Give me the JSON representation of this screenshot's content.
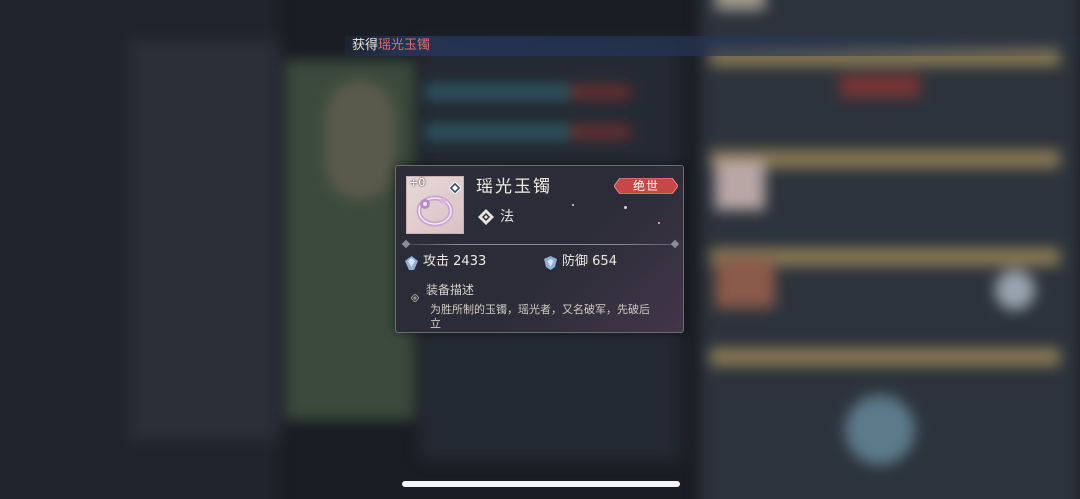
{
  "banner": {
    "prefix": "获得",
    "item_name": "瑶光玉镯"
  },
  "item": {
    "enhance_level": "+0",
    "name": "瑶光玉镯",
    "rarity": "绝世",
    "type": "法",
    "stats": [
      {
        "label": "攻击",
        "value": "2433",
        "icon": "attack-gem-icon"
      },
      {
        "label": "防御",
        "value": "654",
        "icon": "defense-gem-icon"
      }
    ],
    "description_title": "装备描述",
    "description": "为胜所制的玉镯，瑶光者，又名破军，先破后立"
  },
  "colors": {
    "rarity_badge": "#c74747",
    "banner_item": "#e56a6a",
    "panel_bg": "#2c2d39"
  }
}
